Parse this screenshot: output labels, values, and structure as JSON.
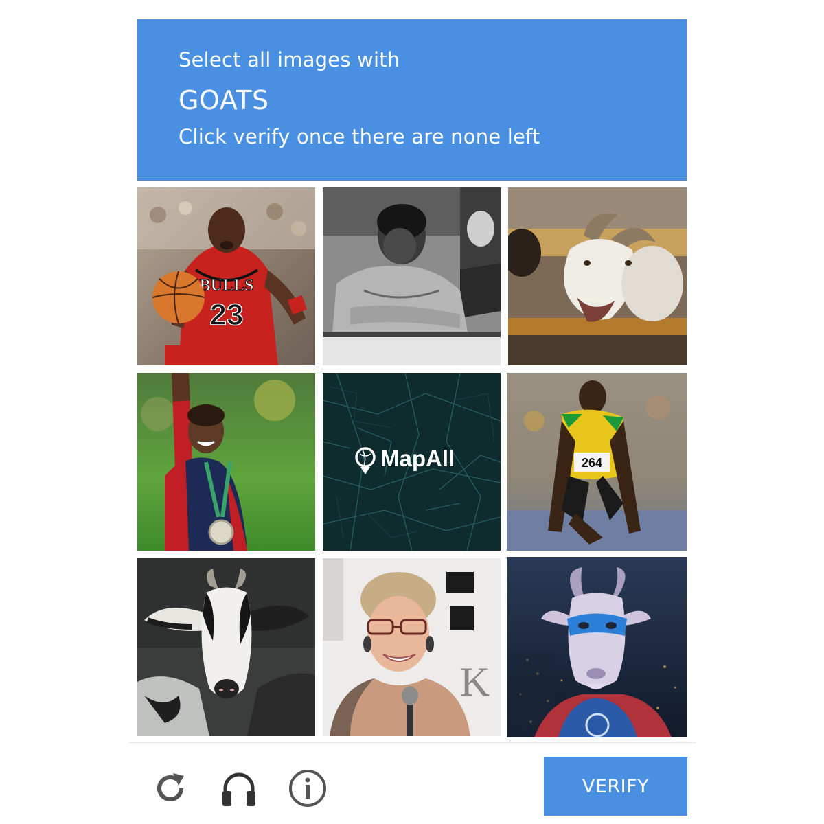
{
  "header": {
    "instruction": "Select all images with",
    "target": "GOATS",
    "hint": "Click verify once there are none left",
    "background_color": "#4a90e2"
  },
  "grid": {
    "tiles": [
      {
        "subject": "basketball player in red number 23 jersey dribbling",
        "jersey_text": "BULLS",
        "jersey_number": "23"
      },
      {
        "subject": "black and white photo of a boxer leaning on ropes"
      },
      {
        "subject": "white goat with open mouth behind a wooden fence"
      },
      {
        "subject": "gymnast raising arm wearing a medal"
      },
      {
        "subject": "dark teal city map with logo",
        "logo_text": "MapAll"
      },
      {
        "subject": "sprinter in yellow and green kit crouched at starting blocks",
        "bib_number": "264"
      },
      {
        "subject": "black and white goat portrait on dark background"
      },
      {
        "subject": "smiling woman with glasses speaking into a microphone"
      },
      {
        "subject": "cartoon goat wearing a blue superhero mask and cape"
      }
    ]
  },
  "footer": {
    "reload_icon": "reload-icon",
    "audio_icon": "headphones-icon",
    "info_icon": "info-icon",
    "verify_label": "VERIFY",
    "verify_color": "#4a90e2"
  }
}
